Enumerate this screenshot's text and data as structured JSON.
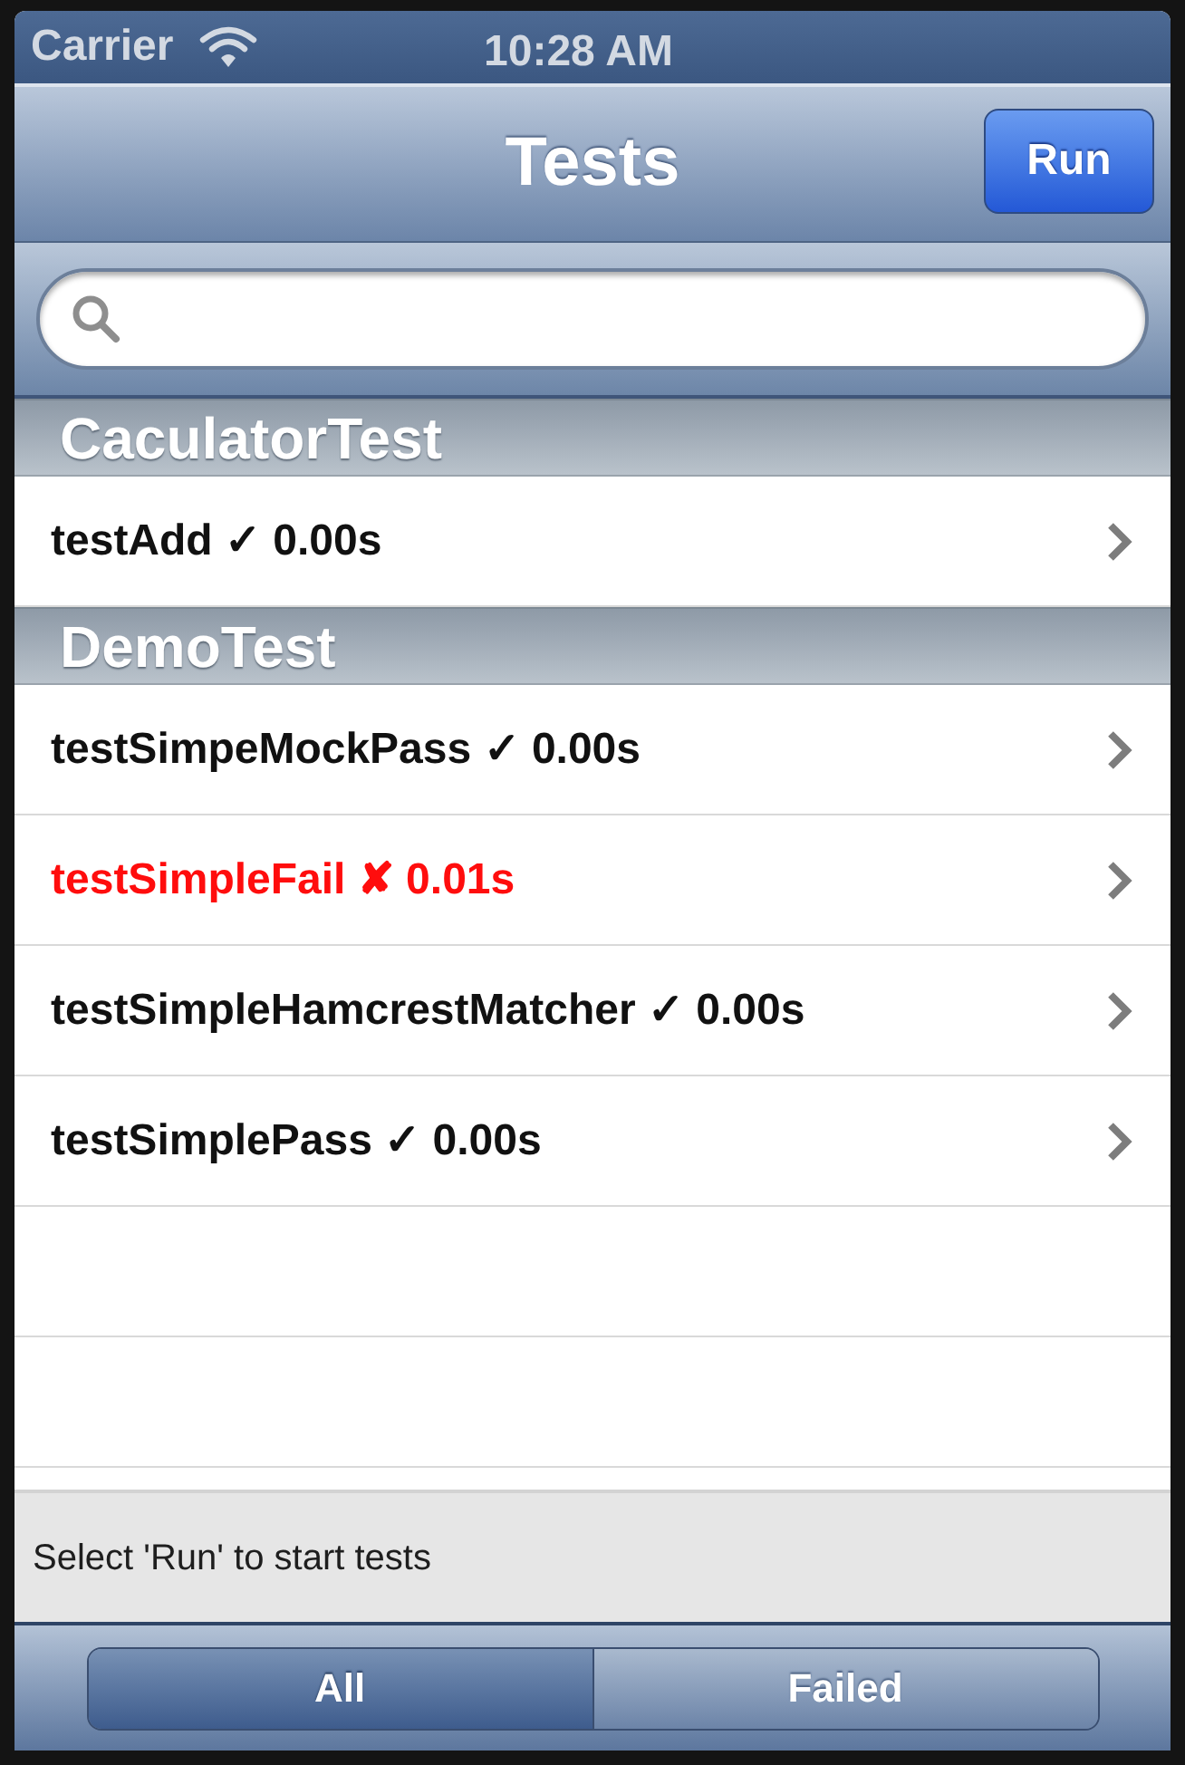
{
  "status_bar": {
    "carrier": "Carrier",
    "time": "10:28 AM"
  },
  "nav_bar": {
    "title": "Tests",
    "run_button": "Run"
  },
  "sections": [
    {
      "title": "CaculatorTest",
      "tests": [
        {
          "label": "testAdd ✓ 0.00s",
          "failed": false
        }
      ]
    },
    {
      "title": "DemoTest",
      "tests": [
        {
          "label": "testSimpeMockPass ✓ 0.00s",
          "failed": false
        },
        {
          "label": "testSimpleFail ✘ 0.01s",
          "failed": true
        },
        {
          "label": "testSimpleHamcrestMatcher ✓ 0.00s",
          "failed": false
        },
        {
          "label": "testSimplePass ✓ 0.00s",
          "failed": false
        }
      ]
    }
  ],
  "message": "Select 'Run' to start tests",
  "filter_tabs": [
    {
      "label": "All",
      "selected": true
    },
    {
      "label": "Failed",
      "selected": false
    }
  ]
}
